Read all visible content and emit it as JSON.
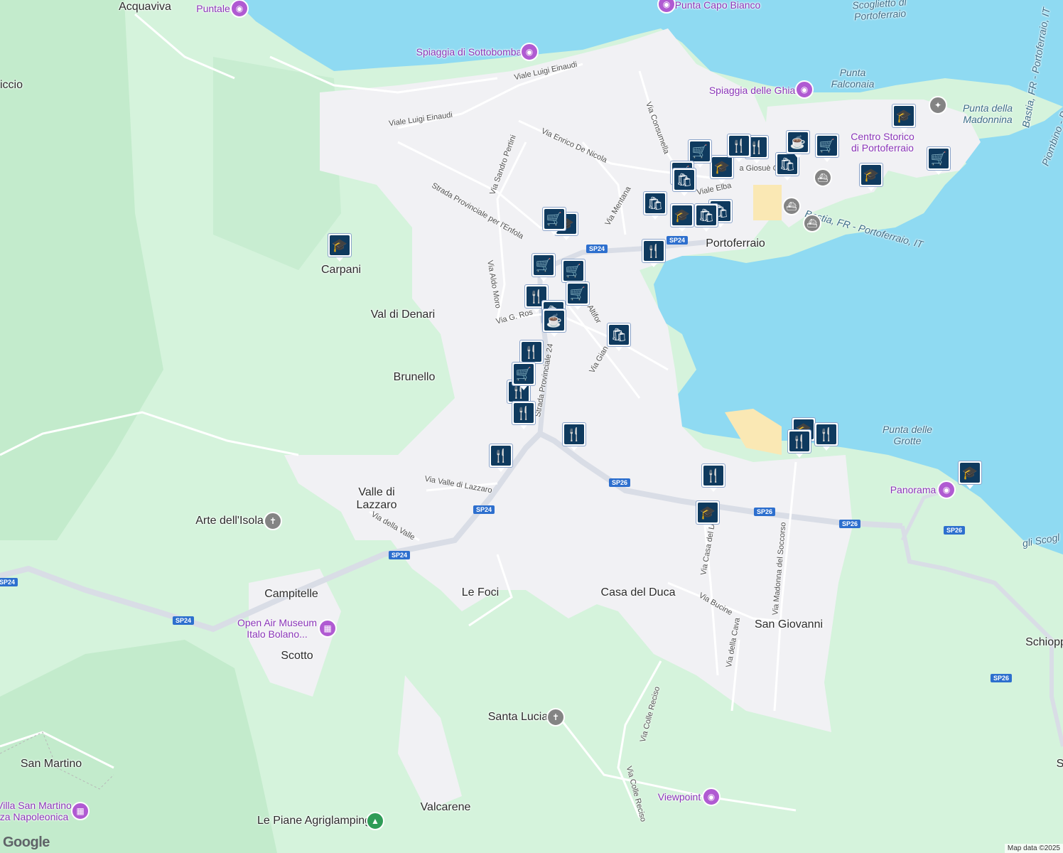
{
  "map": {
    "labels": [
      {
        "id": "acquaviva",
        "text": "Acquaviva",
        "kind": "town"
      },
      {
        "id": "puntale",
        "text": "Puntale",
        "kind": "poi"
      },
      {
        "id": "punta-capo-bianco",
        "text": "Punta Capo Bianco",
        "kind": "poi"
      },
      {
        "id": "scoglietto",
        "text": "Scoglietto di\nPortoferraio",
        "kind": "water"
      },
      {
        "id": "spiaggia-sottobomba",
        "text": "Spiaggia di Sottobomba",
        "kind": "poi"
      },
      {
        "id": "viale-einaudi-1",
        "text": "Viale Luigi Einaudi",
        "kind": "small"
      },
      {
        "id": "viale-einaudi-2",
        "text": "Viale Luigi Einaudi",
        "kind": "small"
      },
      {
        "id": "iccio",
        "text": "iccio",
        "kind": "town"
      },
      {
        "id": "punta-falconaia",
        "text": "Punta\nFalconaia",
        "kind": "water"
      },
      {
        "id": "spiaggia-ghiaie",
        "text": "Spiaggia delle Ghiaie",
        "kind": "poi"
      },
      {
        "id": "punta-madonnina",
        "text": "Punta della\nMadonnina",
        "kind": "water"
      },
      {
        "id": "via-consumella",
        "text": "Via Consumella",
        "kind": "small"
      },
      {
        "id": "via-de-nicola",
        "text": "Via Enrico De Nicola",
        "kind": "small"
      },
      {
        "id": "via-pertini",
        "text": "Via Sandro Pertini",
        "kind": "small"
      },
      {
        "id": "centro-storico",
        "text": "Centro Storico\ndi Portoferraio",
        "kind": "poi"
      },
      {
        "id": "strada-enfola",
        "text": "Strada Provinciale per l'Enfola",
        "kind": "small"
      },
      {
        "id": "via-mentana",
        "text": "Via Mentana",
        "kind": "small"
      },
      {
        "id": "viale-elba",
        "text": "Viale Elba",
        "kind": "small"
      },
      {
        "id": "via-giosue",
        "text": "a Giosuè C",
        "kind": "small"
      },
      {
        "id": "ferry-1",
        "text": "Bastia, FR - Portoferraio, IT",
        "kind": "water"
      },
      {
        "id": "ferry-2",
        "text": "Bastia, FR - Portoferraio, IT",
        "kind": "water"
      },
      {
        "id": "ferry-3",
        "text": "Piombino - P",
        "kind": "water"
      },
      {
        "id": "portoferraio",
        "text": "Portoferraio",
        "kind": "town"
      },
      {
        "id": "carpani",
        "text": "Carpani",
        "kind": "town"
      },
      {
        "id": "via-aldo-moro",
        "text": "Via Aldo Moro",
        "kind": "small"
      },
      {
        "id": "val-di-denari",
        "text": "Val di Denari",
        "kind": "town"
      },
      {
        "id": "via-g-ros",
        "text": "Via G. Ros",
        "kind": "small"
      },
      {
        "id": "altiforni",
        "text": "Altifor",
        "kind": "small"
      },
      {
        "id": "via-gian",
        "text": "Via Gian",
        "kind": "small"
      },
      {
        "id": "brunello",
        "text": "Brunello",
        "kind": "town"
      },
      {
        "id": "strada-prov-24",
        "text": "Strada Provinciale 24",
        "kind": "small"
      },
      {
        "id": "punta-grotte",
        "text": "Punta delle\nGrotte",
        "kind": "water"
      },
      {
        "id": "panorama",
        "text": "Panorama",
        "kind": "poi"
      },
      {
        "id": "valle-lazzaro",
        "text": "Valle di\nLazzaro",
        "kind": "town"
      },
      {
        "id": "via-valle-lazzaro",
        "text": "Via Valle di Lazzaro",
        "kind": "small"
      },
      {
        "id": "via-della-valle",
        "text": "Via della Valle",
        "kind": "small"
      },
      {
        "id": "arte-isola",
        "text": "Arte dell'Isola",
        "kind": "town"
      },
      {
        "id": "gli-scogli",
        "text": "gli Scogl",
        "kind": "water"
      },
      {
        "id": "via-casa-duca",
        "text": "Via Casa del Du",
        "kind": "small"
      },
      {
        "id": "via-madonna-soccorso",
        "text": "Via Madonna del Soccorso",
        "kind": "small"
      },
      {
        "id": "campitelle",
        "text": "Campitelle",
        "kind": "town"
      },
      {
        "id": "le-foci",
        "text": "Le Foci",
        "kind": "town"
      },
      {
        "id": "casa-del-duca",
        "text": "Casa del Duca",
        "kind": "town"
      },
      {
        "id": "via-bucine",
        "text": "Via Bucine",
        "kind": "small"
      },
      {
        "id": "san-giovanni",
        "text": "San Giovanni",
        "kind": "town"
      },
      {
        "id": "open-air-museum",
        "text": "Open Air Museum\nItalo Bolano...",
        "kind": "poi"
      },
      {
        "id": "via-della-cava",
        "text": "Via della Cava",
        "kind": "small"
      },
      {
        "id": "schiopp",
        "text": "Schiopp",
        "kind": "town"
      },
      {
        "id": "scotto",
        "text": "Scotto",
        "kind": "town"
      },
      {
        "id": "via-colle-reciso-1",
        "text": "Via Colle Reciso",
        "kind": "small"
      },
      {
        "id": "santa-lucia",
        "text": "Santa Lucia",
        "kind": "town"
      },
      {
        "id": "san-martino",
        "text": "San Martino",
        "kind": "town"
      },
      {
        "id": "via-colle-reciso-2",
        "text": "Via Colle Reciso",
        "kind": "small"
      },
      {
        "id": "viewpoint",
        "text": "Viewpoint",
        "kind": "poi"
      },
      {
        "id": "villa-san-martino",
        "text": "Villa San Martino\nza Napoleonica",
        "kind": "poi"
      },
      {
        "id": "valcarene",
        "text": "Valcarene",
        "kind": "town"
      },
      {
        "id": "le-piane",
        "text": "Le Piane Agriglamping",
        "kind": "town"
      },
      {
        "id": "s-edge",
        "text": "S",
        "kind": "town"
      }
    ],
    "road_shields": [
      "SP24",
      "SP24",
      "SP24",
      "SP24",
      "SP24",
      "SP26",
      "SP26",
      "SP26",
      "SP26",
      "SP26"
    ],
    "markers": [
      {
        "type": "school"
      },
      {
        "type": "school"
      },
      {
        "type": "school"
      },
      {
        "type": "school"
      },
      {
        "type": "school"
      },
      {
        "type": "school"
      },
      {
        "type": "school"
      },
      {
        "type": "school"
      },
      {
        "type": "school"
      },
      {
        "type": "restaurant"
      },
      {
        "type": "restaurant"
      },
      {
        "type": "restaurant"
      },
      {
        "type": "restaurant"
      },
      {
        "type": "restaurant"
      },
      {
        "type": "restaurant"
      },
      {
        "type": "restaurant"
      },
      {
        "type": "restaurant"
      },
      {
        "type": "restaurant"
      },
      {
        "type": "restaurant"
      },
      {
        "type": "restaurant"
      },
      {
        "type": "restaurant"
      },
      {
        "type": "grocery"
      },
      {
        "type": "grocery"
      },
      {
        "type": "grocery"
      },
      {
        "type": "grocery"
      },
      {
        "type": "grocery"
      },
      {
        "type": "grocery"
      },
      {
        "type": "grocery"
      },
      {
        "type": "grocery"
      },
      {
        "type": "grocery"
      },
      {
        "type": "shopping"
      },
      {
        "type": "shopping"
      },
      {
        "type": "shopping"
      },
      {
        "type": "shopping"
      },
      {
        "type": "shopping"
      },
      {
        "type": "shopping"
      },
      {
        "type": "shopping"
      },
      {
        "type": "cafe"
      },
      {
        "type": "cafe"
      }
    ],
    "icon_glyphs": {
      "school": "🎓",
      "restaurant": "🍴",
      "grocery": "🛒",
      "shopping": "🛍",
      "cafe": "☕"
    },
    "colors": {
      "water": "#8fdaf2",
      "land": "#d5f3dc",
      "urban": "#f1f1f4",
      "road": "#ffffff",
      "major_road": "#d9dde6",
      "marker": "#0f3a5e",
      "poi": "#b05ad2"
    }
  },
  "footer": {
    "logo": "Google",
    "attribution": "Map data ©2025"
  }
}
